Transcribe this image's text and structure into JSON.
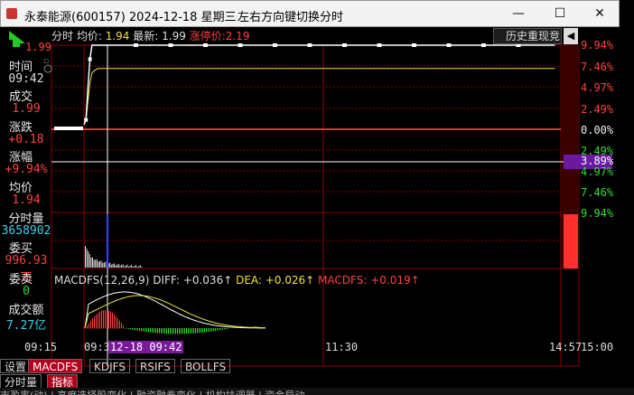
{
  "window": {
    "title": "永泰能源(600157) 2024-12-18 星期三",
    "hint": "左右方向键切换分时",
    "minimize": "—",
    "maximize": "☐",
    "close": "✕"
  },
  "price_top": "1.99",
  "info": {
    "time_label": "时间",
    "time_value": "09:42",
    "deal_label": "成交",
    "deal_value": "1.99",
    "change_label": "涨跌",
    "change_value": "+0.18",
    "pct_label": "涨幅",
    "pct_value": "+9.94%",
    "avg_label": "均价",
    "avg_value": "1.94",
    "vol_label": "分时量",
    "vol_value": "3658902",
    "bid_label": "委买",
    "bid_value": "996.93万",
    "ask_label": "委卖",
    "ask_value": "0",
    "amount_label": "成交额",
    "amount_value": "7.27亿"
  },
  "header": {
    "label": "分时",
    "avg_label": "均价:",
    "avg_value": "1.94",
    "latest_label": "最新:",
    "latest_value": "1.99",
    "limit_label": "涨停价:",
    "limit_value": "2.19",
    "history_btn": "历史重现",
    "jing_btn": "竞",
    "collapse_btn": "◀"
  },
  "pct_axis_up": [
    "9.94%",
    "7.46%",
    "4.97%",
    "2.49%"
  ],
  "pct_axis_zero": "0.00%",
  "pct_axis_down": [
    "2.49%",
    "4.97%",
    "7.46%",
    "9.94%"
  ],
  "cursor_pct": "3.89%",
  "macd": {
    "name": "MACDFS(12,26,9)",
    "diff": "DIFF: +0.036↑",
    "dea": "DEA: +0.026↑",
    "macdfs": "MACDFS: +0.019↑"
  },
  "time_axis": {
    "t0": "09:15",
    "t1": "09:30",
    "cursor": "12-18 09:42",
    "t2": "11:30",
    "t3": "14:57",
    "t4": "15:00"
  },
  "tabs_row1": [
    "设置",
    "MACDFS",
    "KDJFS",
    "RSIFS",
    "BOLLFS"
  ],
  "tabs_row2": [
    "分时量",
    "指标"
  ],
  "status": "市盈率(动)  |  高度选择股变化  |  融资融券变化  |  机构抹调器  |  资金异动",
  "colors": {
    "up": "#ff4040",
    "down": "#33dd33",
    "grid": "#8b0000",
    "price_line": "#ffffff",
    "avg_line": "#f0e040"
  },
  "chart_data": {
    "type": "line",
    "x": [
      "09:30",
      "09:31",
      "09:32",
      "09:33",
      "09:34",
      "09:35",
      "09:37",
      "09:40",
      "09:42",
      "10:00",
      "10:30",
      "11:00",
      "11:30",
      "13:30",
      "14:00",
      "14:30",
      "14:57"
    ],
    "series": [
      {
        "values": [
          1.82,
          1.83,
          1.9,
          1.96,
          1.99,
          1.99,
          1.99,
          1.99,
          1.99,
          1.99,
          1.99,
          1.99,
          1.99,
          1.99,
          1.99,
          1.99,
          1.99
        ]
      },
      {
        "values": [
          1.82,
          1.83,
          1.87,
          1.91,
          1.93,
          1.935,
          1.94,
          1.94,
          1.94,
          1.94,
          1.94,
          1.94,
          1.94,
          1.94,
          1.94,
          1.94,
          1.94
        ]
      }
    ],
    "ylim": [
      1.63,
      1.99
    ],
    "grid": true
  }
}
